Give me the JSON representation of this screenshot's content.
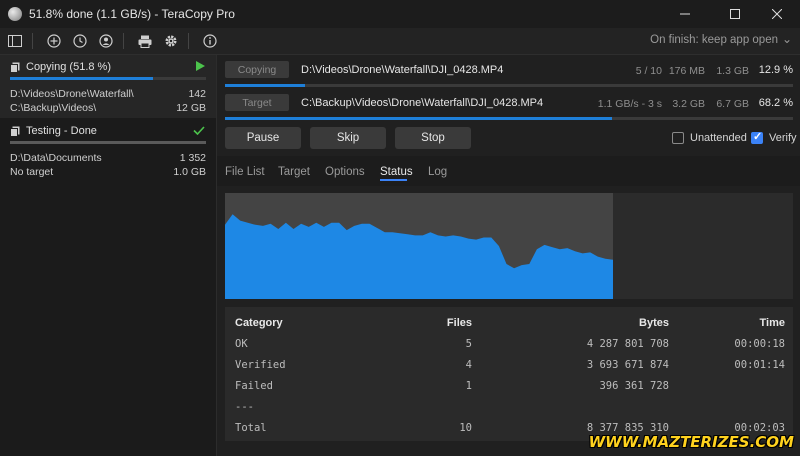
{
  "window": {
    "title": "51.8% done (1.1 GB/s) - TeraCopy Pro",
    "on_finish": "On finish: keep app open"
  },
  "jobs": [
    {
      "title": "Copying (51.8 %)",
      "progress": 0.73,
      "src": "D:\\Videos\\Drone\\Waterfall\\",
      "src_count": "142",
      "dst": "C:\\Backup\\Videos\\",
      "dst_size": "12 GB",
      "status_icon": "play-icon"
    },
    {
      "title": "Testing - Done",
      "progress": 1.0,
      "src": "D:\\Data\\Documents",
      "src_count": "1 352",
      "dst": "No target",
      "dst_size": "1.0 GB",
      "status_icon": "check-icon"
    }
  ],
  "transfer": {
    "copying_label": "Copying",
    "source_path": "D:\\Videos\\Drone\\Waterfall\\DJI_0428.MP4",
    "files": "5 / 10",
    "size_done": "176 MB",
    "size_total": "1.3 GB",
    "percent": "12.9 %",
    "source_progress": 0.14,
    "target_label": "Target",
    "target_path": "C:\\Backup\\Videos\\Drone\\Waterfall\\DJI_0428.MP4",
    "speed": "1.1 GB/s - 3 s",
    "t_done": "3.2 GB",
    "t_total": "6.7 GB",
    "t_percent": "68.2 %",
    "target_progress": 0.682
  },
  "actions": {
    "pause": "Pause",
    "skip": "Skip",
    "stop": "Stop",
    "unattended": "Unattended",
    "unattended_checked": false,
    "verify": "Verify",
    "verify_checked": true
  },
  "tabs": [
    "File List",
    "Target",
    "Options",
    "Status",
    "Log"
  ],
  "active_tab": "Status",
  "speed_graph": {
    "values": [
      0.7,
      0.8,
      0.74,
      0.72,
      0.7,
      0.69,
      0.71,
      0.66,
      0.72,
      0.66,
      0.71,
      0.68,
      0.72,
      0.68,
      0.72,
      0.72,
      0.65,
      0.69,
      0.71,
      0.71,
      0.67,
      0.63,
      0.63,
      0.62,
      0.61,
      0.6,
      0.6,
      0.63,
      0.6,
      0.59,
      0.6,
      0.59,
      0.57,
      0.56,
      0.58,
      0.58,
      0.5,
      0.33,
      0.29,
      0.32,
      0.33,
      0.47,
      0.51,
      0.49,
      0.47,
      0.48,
      0.45,
      0.43,
      0.44,
      0.4,
      0.38,
      0.37
    ]
  },
  "status_table": {
    "headers": [
      "Category",
      "Files",
      "Bytes",
      "Time"
    ],
    "rows": [
      [
        "OK",
        "5",
        "4 287 801 708",
        "00:00:18"
      ],
      [
        "Verified",
        "4",
        "3 693 671 874",
        "00:01:14"
      ],
      [
        "Failed",
        "1",
        "396 361 728",
        ""
      ],
      [
        "---",
        "",
        "",
        ""
      ],
      [
        "Total",
        "10",
        "8 377 835 310",
        "00:02:03"
      ]
    ]
  },
  "watermark": "WWW.MAZTERIZES.COM"
}
